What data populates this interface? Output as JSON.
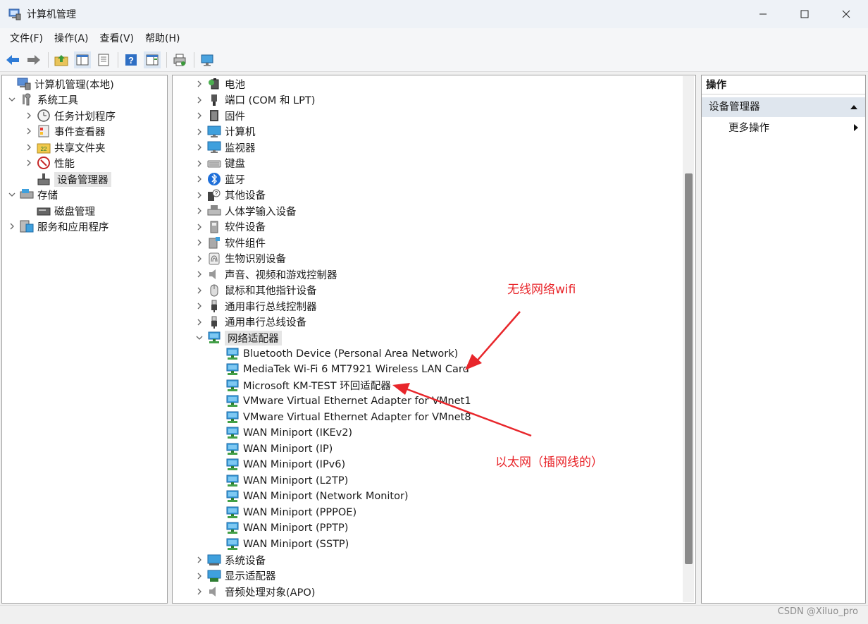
{
  "window": {
    "title": "计算机管理",
    "controls": [
      "—",
      "☐",
      "✕"
    ]
  },
  "menubar": [
    "文件(F)",
    "操作(A)",
    "查看(V)",
    "帮助(H)"
  ],
  "left_tree": [
    {
      "label": "计算机管理(本地)",
      "icon": "computer-management-icon",
      "chev": ""
    },
    {
      "label": "系统工具",
      "icon": "system-tools-icon",
      "chev": "˅"
    },
    {
      "label": "任务计划程序",
      "icon": "clock-icon",
      "chev": "›"
    },
    {
      "label": "事件查看器",
      "icon": "event-viewer-icon",
      "chev": "›"
    },
    {
      "label": "共享文件夹",
      "icon": "shared-folder-icon",
      "chev": "›"
    },
    {
      "label": "性能",
      "icon": "performance-icon",
      "chev": "›"
    },
    {
      "label": "设备管理器",
      "icon": "device-manager-icon",
      "chev": ""
    },
    {
      "label": "存储",
      "icon": "storage-icon",
      "chev": "˅"
    },
    {
      "label": "磁盘管理",
      "icon": "disk-icon",
      "chev": ""
    },
    {
      "label": "服务和应用程序",
      "icon": "services-icon",
      "chev": "›"
    }
  ],
  "device_tree": [
    {
      "label": "电池",
      "icon": "battery-icon",
      "chev": "›"
    },
    {
      "label": "端口 (COM 和 LPT)",
      "icon": "port-icon",
      "chev": "›"
    },
    {
      "label": "固件",
      "icon": "firmware-icon",
      "chev": "›"
    },
    {
      "label": "计算机",
      "icon": "monitor-icon",
      "chev": "›"
    },
    {
      "label": "监视器",
      "icon": "monitor-icon",
      "chev": "›"
    },
    {
      "label": "键盘",
      "icon": "keyboard-icon",
      "chev": "›"
    },
    {
      "label": "蓝牙",
      "icon": "bluetooth-icon",
      "chev": "›"
    },
    {
      "label": "其他设备",
      "icon": "unknown-device-icon",
      "chev": "›"
    },
    {
      "label": "人体学输入设备",
      "icon": "hid-icon",
      "chev": "›"
    },
    {
      "label": "软件设备",
      "icon": "software-device-icon",
      "chev": "›"
    },
    {
      "label": "软件组件",
      "icon": "software-component-icon",
      "chev": "›"
    },
    {
      "label": "生物识别设备",
      "icon": "fingerprint-icon",
      "chev": "›"
    },
    {
      "label": "声音、视频和游戏控制器",
      "icon": "speaker-icon",
      "chev": "›"
    },
    {
      "label": "鼠标和其他指针设备",
      "icon": "mouse-icon",
      "chev": "›"
    },
    {
      "label": "通用串行总线控制器",
      "icon": "usb-icon",
      "chev": "›"
    },
    {
      "label": "通用串行总线设备",
      "icon": "usb-icon",
      "chev": "›"
    },
    {
      "label": "网络适配器",
      "icon": "network-adapter-icon",
      "chev": "˅"
    },
    {
      "label": "Bluetooth Device (Personal Area Network)",
      "icon": "network-adapter-icon",
      "chev": "",
      "child": true
    },
    {
      "label": "MediaTek Wi-Fi 6 MT7921 Wireless LAN Card",
      "icon": "network-adapter-icon",
      "chev": "",
      "child": true
    },
    {
      "label": "Microsoft KM-TEST 环回适配器",
      "icon": "network-adapter-icon",
      "chev": "",
      "child": true
    },
    {
      "label": "VMware Virtual Ethernet Adapter for VMnet1",
      "icon": "network-adapter-icon",
      "chev": "",
      "child": true
    },
    {
      "label": "VMware Virtual Ethernet Adapter for VMnet8",
      "icon": "network-adapter-icon",
      "chev": "",
      "child": true
    },
    {
      "label": "WAN Miniport (IKEv2)",
      "icon": "network-adapter-icon",
      "chev": "",
      "child": true
    },
    {
      "label": "WAN Miniport (IP)",
      "icon": "network-adapter-icon",
      "chev": "",
      "child": true
    },
    {
      "label": "WAN Miniport (IPv6)",
      "icon": "network-adapter-icon",
      "chev": "",
      "child": true
    },
    {
      "label": "WAN Miniport (L2TP)",
      "icon": "network-adapter-icon",
      "chev": "",
      "child": true
    },
    {
      "label": "WAN Miniport (Network Monitor)",
      "icon": "network-adapter-icon",
      "chev": "",
      "child": true
    },
    {
      "label": "WAN Miniport (PPPOE)",
      "icon": "network-adapter-icon",
      "chev": "",
      "child": true
    },
    {
      "label": "WAN Miniport (PPTP)",
      "icon": "network-adapter-icon",
      "chev": "",
      "child": true
    },
    {
      "label": "WAN Miniport (SSTP)",
      "icon": "network-adapter-icon",
      "chev": "",
      "child": true
    },
    {
      "label": "系统设备",
      "icon": "system-device-icon",
      "chev": "›"
    },
    {
      "label": "显示适配器",
      "icon": "display-adapter-icon",
      "chev": "›"
    },
    {
      "label": "音频处理对象(APO)",
      "icon": "speaker-icon",
      "chev": "›"
    }
  ],
  "actions_pane": {
    "header": "操作",
    "section": "设备管理器",
    "more": "更多操作"
  },
  "annotations": {
    "wifi": "无线网络wifi",
    "ethernet": "以太网（插网线的）",
    "color": "#e8262b"
  },
  "watermark": "CSDN @Xiluo_pro"
}
